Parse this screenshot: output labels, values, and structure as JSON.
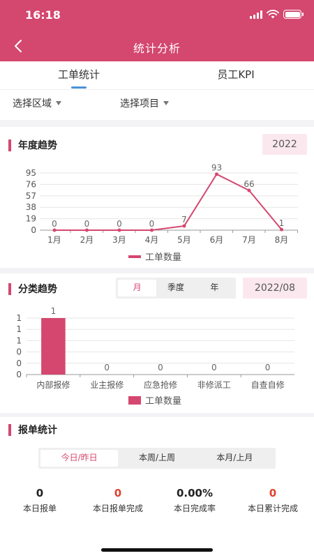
{
  "status_bar": {
    "time": "16:18"
  },
  "header": {
    "title": "统计分析"
  },
  "tabs": [
    {
      "label": "工单统计",
      "active": true
    },
    {
      "label": "员工KPI",
      "active": false
    }
  ],
  "filters": {
    "area": "选择区域",
    "project": "选择项目"
  },
  "annual": {
    "title": "年度趋势",
    "year": "2022",
    "legend": "工单数量"
  },
  "category": {
    "title": "分类趋势",
    "segments": [
      "月",
      "季度",
      "年"
    ],
    "active_segment": 0,
    "period": "2022/08",
    "legend": "工单数量"
  },
  "report": {
    "title": "报单统计",
    "segments": [
      "今日/昨日",
      "本周/上周",
      "本月/上月"
    ],
    "active_segment": 0,
    "stats": [
      {
        "value": "0",
        "label": "本日报单",
        "highlight": false
      },
      {
        "value": "0",
        "label": "本日报单完成",
        "highlight": true
      },
      {
        "value": "0.00%",
        "label": "本日完成率",
        "highlight": false
      },
      {
        "value": "0",
        "label": "本日累计完成",
        "highlight": true
      }
    ]
  },
  "colors": {
    "accent": "#d4476f",
    "tab_indicator": "#4a90d9",
    "highlight": "#e0402f",
    "chip_bg": "#fbe8ee"
  },
  "chart_data": [
    {
      "type": "line",
      "categories": [
        "1月",
        "2月",
        "3月",
        "4月",
        "5月",
        "6月",
        "7月",
        "8月"
      ],
      "series": [
        {
          "name": "工单数量",
          "values": [
            0,
            0,
            0,
            0,
            7,
            93,
            66,
            1
          ]
        }
      ],
      "yticks": [
        "0",
        "19",
        "38",
        "57",
        "76",
        "95"
      ],
      "ylim": [
        0,
        95
      ],
      "grid": true,
      "legend": "bottom"
    },
    {
      "type": "bar",
      "categories": [
        "内部报修",
        "业主报修",
        "应急抢修",
        "非修派工",
        "自查自修"
      ],
      "series": [
        {
          "name": "工单数量",
          "values": [
            1,
            0,
            0,
            0,
            0
          ]
        }
      ],
      "yticks": [
        "0",
        "0",
        "0",
        "1",
        "1",
        "1"
      ],
      "ylim": [
        0,
        1
      ],
      "grid": true,
      "legend": "bottom"
    }
  ]
}
